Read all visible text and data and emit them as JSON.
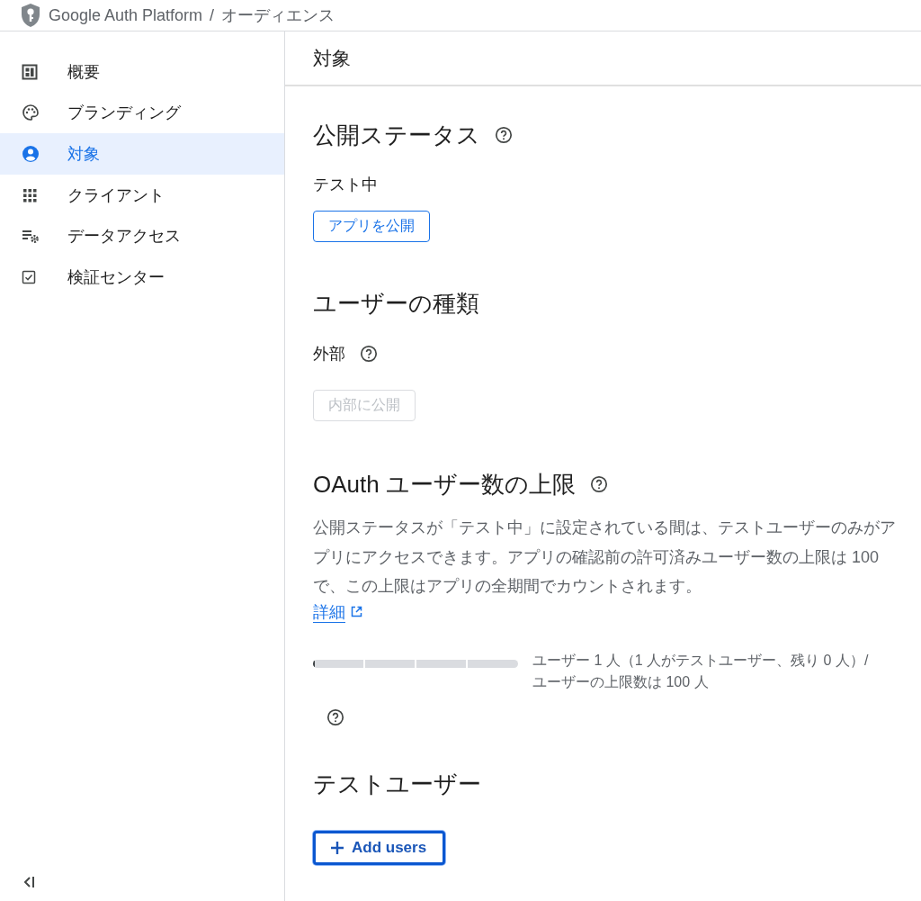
{
  "header": {
    "product": "Google Auth Platform",
    "separator": "/",
    "page": "オーディエンス"
  },
  "sidebar": {
    "items": [
      {
        "label": "概要",
        "selected": false
      },
      {
        "label": "ブランディング",
        "selected": false
      },
      {
        "label": "対象",
        "selected": true
      },
      {
        "label": "クライアント",
        "selected": false
      },
      {
        "label": "データアクセス",
        "selected": false
      },
      {
        "label": "検証センター",
        "selected": false
      }
    ]
  },
  "main": {
    "title": "対象",
    "publishing_status": {
      "heading": "公開ステータス",
      "status": "テスト中",
      "button": {
        "label": "アプリを公開",
        "disabled": false
      }
    },
    "user_type": {
      "heading": "ユーザーの種類",
      "value": "外部",
      "button": {
        "label": "内部に公開",
        "disabled": true
      }
    },
    "oauth_limit": {
      "heading": "OAuth ユーザー数の上限",
      "description": "公開ステータスが「テスト中」に設定されている間は、テストユーザーのみがアプリにアクセスできます。アプリの確認前の許可済みユーザー数の上限は 100 で、この上限はアプリの全期間でカウントされます。",
      "link": "詳細",
      "meter": {
        "level": 0.01
      },
      "reading": "ユーザー 1 人（1 人がテストユーザー、残り 0 人）/ ユーザーの上限数は 100 人"
    },
    "test_users": {
      "heading": "テストユーザー",
      "button": {
        "label": "Add users",
        "focused": true
      }
    }
  }
}
